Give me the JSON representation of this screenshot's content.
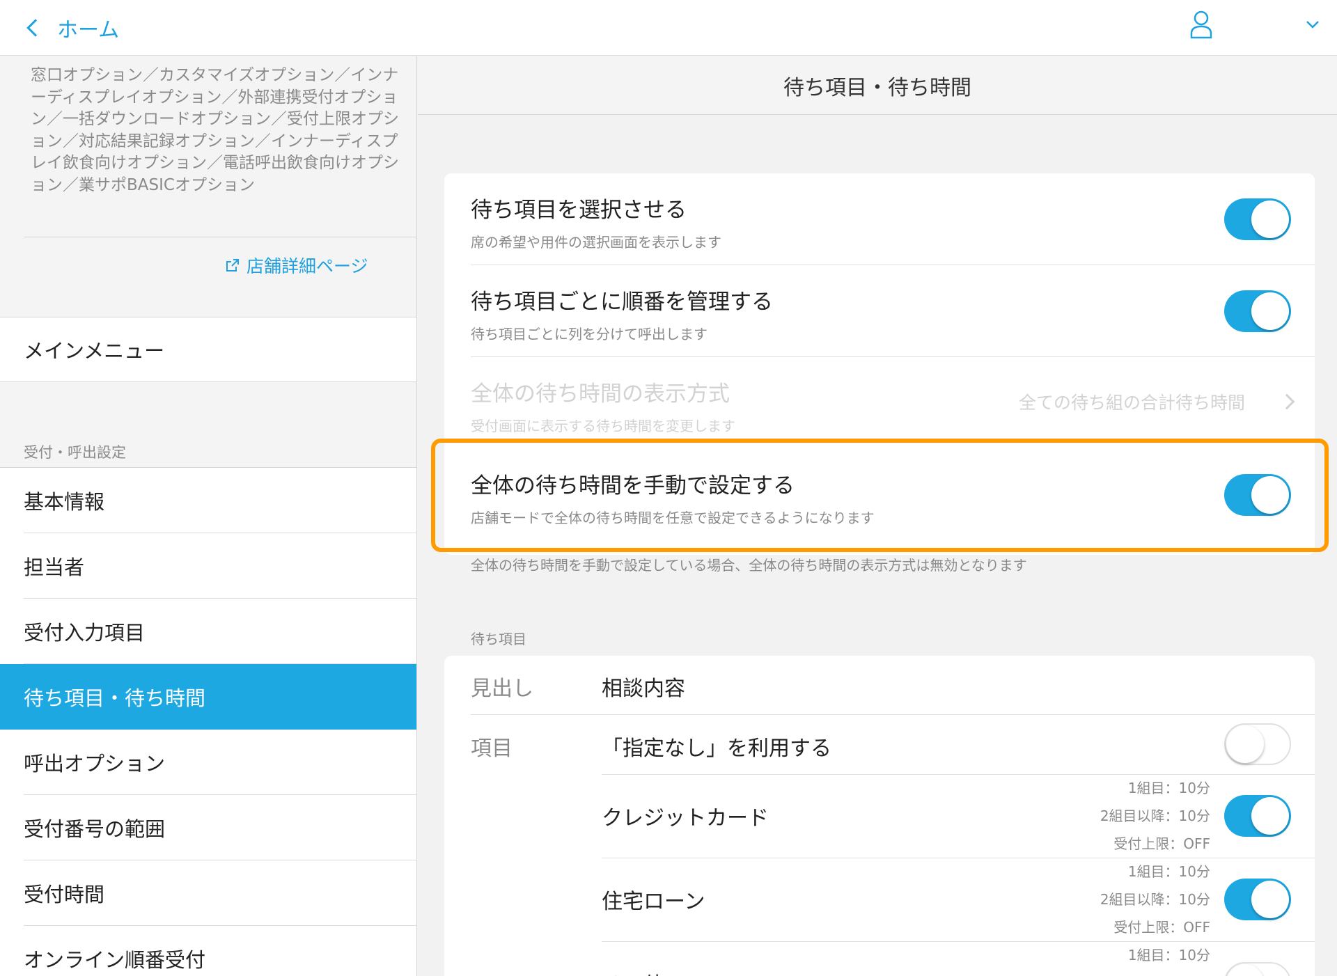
{
  "topbar": {
    "back_label": "ホーム"
  },
  "sidebar": {
    "options_text": "窓口オプション／カスタマイズオプション／インナーディスプレイオプション／外部連携受付オプション／一括ダウンロードオプション／受付上限オプション／対応結果記録オプション／インナーディスプレイ飲食向けオプション／電話呼出飲食向けオプション／業サポBASICオプション",
    "detail_link": "店舗詳細ページ",
    "main_menu": "メインメニュー",
    "section_label": "受付・呼出設定",
    "items": [
      {
        "label": "基本情報"
      },
      {
        "label": "担当者"
      },
      {
        "label": "受付入力項目"
      },
      {
        "label": "待ち項目・待ち時間"
      },
      {
        "label": "呼出オプション"
      },
      {
        "label": "受付番号の範囲"
      },
      {
        "label": "受付時間"
      },
      {
        "label": "オンライン順番受付"
      }
    ]
  },
  "main": {
    "title": "待ち項目・待ち時間",
    "settings": [
      {
        "title": "待ち項目を選択させる",
        "sub": "席の希望や用件の選択画面を表示します",
        "on": true
      },
      {
        "title": "待ち項目ごとに順番を管理する",
        "sub": "待ち項目ごとに列を分けて呼出します",
        "on": true
      },
      {
        "title": "全体の待ち時間の表示方式",
        "sub": "受付画面に表示する待ち時間を変更します",
        "value": "全ての待ち組の合計待ち時間"
      },
      {
        "title": "全体の待ち時間を手動で設定する",
        "sub": "店舗モードで全体の待ち時間を任意で設定できるようになります",
        "on": true
      }
    ],
    "note": "全体の待ち時間を手動で設定している場合、全体の待ち時間の表示方式は無効となります",
    "items_label": "待ち項目",
    "heading_label": "見出し",
    "heading_value": "相談内容",
    "item_label": "項目",
    "no_preference": "「指定なし」を利用する",
    "wait_items": [
      {
        "name": "クレジットカード",
        "meta1": "1組目：10分",
        "meta2": "2組目以降：10分",
        "meta3": "受付上限：OFF"
      },
      {
        "name": "住宅ローン",
        "meta1": "1組目：10分",
        "meta2": "2組目以降：10分",
        "meta3": "受付上限：OFF"
      },
      {
        "name": "その他",
        "meta1": "1組目：10分"
      }
    ]
  }
}
